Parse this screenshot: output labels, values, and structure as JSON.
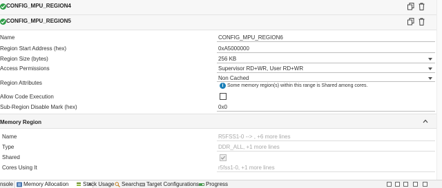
{
  "regions": [
    {
      "title": "CONFIG_MPU_REGION4"
    },
    {
      "title": "CONFIG_MPU_REGION5"
    }
  ],
  "form": {
    "name": {
      "label": "Name",
      "value": "CONFIG_MPU_REGION6"
    },
    "start_address": {
      "label": "Region Start Address (hex)",
      "value": "0xA5000000"
    },
    "size": {
      "label": "Region Size (bytes)",
      "value": "256 KB"
    },
    "access": {
      "label": "Access Permissions",
      "value": "Supervisor RD+WR, User RD+WR"
    },
    "attributes": {
      "label": "Region Attributes",
      "value": "Non Cached",
      "info": "Some memory region(s) within this range is Shared among cores."
    },
    "exec": {
      "label": "Allow Code Execution",
      "checked": false
    },
    "subregion": {
      "label": "Sub-Region Disable Mark (hex)",
      "value": "0x0"
    }
  },
  "memory_region": {
    "title": "Memory Region",
    "name": {
      "label": "Name",
      "value": "R5FSS1-0 --> , +6 more lines"
    },
    "type": {
      "label": "Type",
      "value": "DDR_ALL, +1 more lines"
    },
    "shared": {
      "label": "Shared",
      "checked": true
    },
    "cores": {
      "label": "Cores Using It",
      "value": "r5fss1-0, +1 more lines"
    }
  },
  "tabs": [
    {
      "label": "nsole",
      "active": false
    },
    {
      "label": "Memory Allocation",
      "active": true,
      "close": "✕"
    },
    {
      "label": "Stack Usage",
      "active": false
    },
    {
      "label": "Search",
      "active": false
    },
    {
      "label": "Target Configurations",
      "active": false
    },
    {
      "label": "Progress",
      "active": false
    }
  ],
  "colors": {
    "check_green": "#2e9d46",
    "info_blue": "#1a7fb8"
  }
}
